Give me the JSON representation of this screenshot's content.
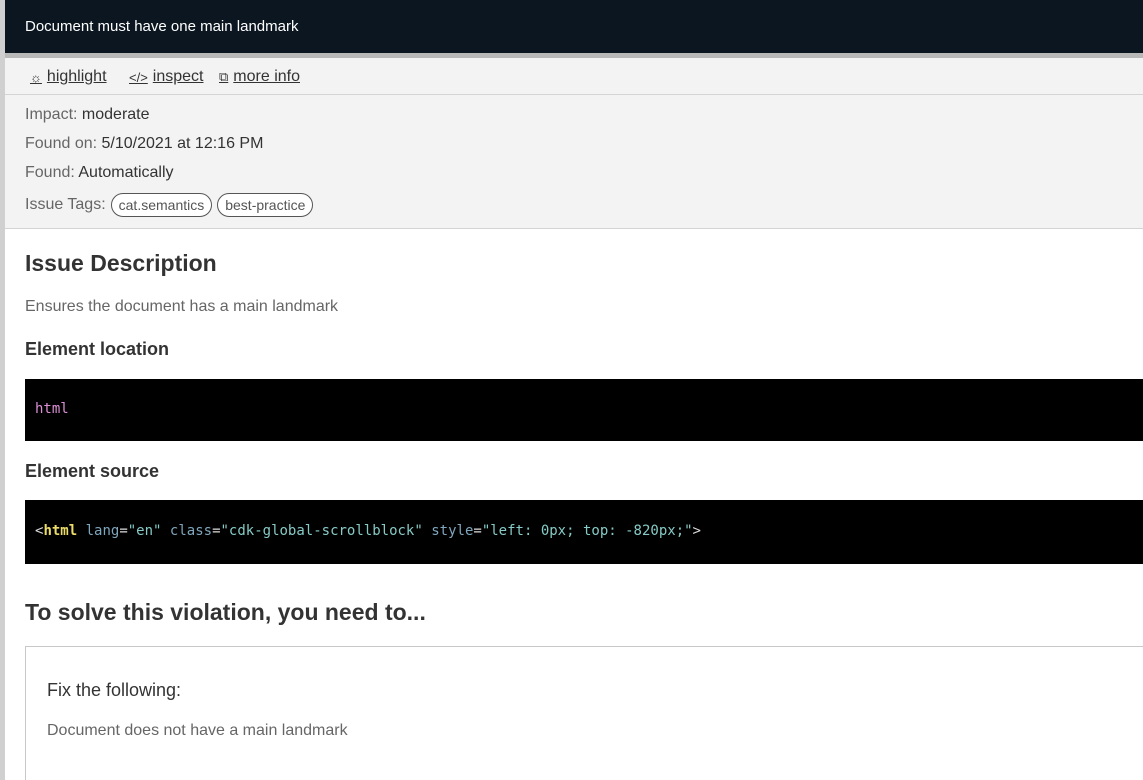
{
  "header": {
    "title": "Document must have one main landmark"
  },
  "actions": {
    "highlight": {
      "icon": "☼",
      "label": "highlight"
    },
    "inspect": {
      "icon": "</>",
      "label": "inspect"
    },
    "more_info": {
      "icon": "⧉",
      "label": "more info"
    }
  },
  "meta": {
    "impact_label": "Impact:",
    "impact_value": "moderate",
    "found_on_label": "Found on:",
    "found_on_value": "5/10/2021 at 12:16 PM",
    "found_label": "Found:",
    "found_value": "Automatically",
    "tags_label": "Issue Tags:",
    "tags": [
      "cat.semantics",
      "best-practice"
    ]
  },
  "description": {
    "title": "Issue Description",
    "text": "Ensures the document has a main landmark"
  },
  "location": {
    "title": "Element location",
    "code": "html"
  },
  "source": {
    "title": "Element source",
    "open": "<",
    "tag": "html",
    "attr1": "lang",
    "eq": "=",
    "val1": "\"en\"",
    "attr2": "class",
    "val2": "\"cdk-global-scrollblock\"",
    "attr3": "style",
    "val3": "\"left: 0px; top: -820px;\"",
    "close": ">"
  },
  "solve": {
    "title": "To solve this violation, you need to...",
    "fix_title": "Fix the following:",
    "fix_text": "Document does not have a main landmark"
  },
  "colors": {
    "header_bg": "#0b1620",
    "code_bg": "#000000",
    "panel_bg": "#f3f3f3"
  }
}
